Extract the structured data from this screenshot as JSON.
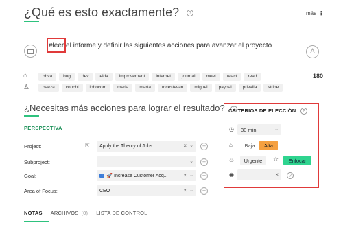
{
  "header": {
    "title": "¿Qué es esto exactamente?",
    "more_label": "más",
    "help_glyph": "?"
  },
  "action": {
    "hashtag": "#leer",
    "text": " el informe y definir las siguientes acciones para avanzar el proyecto"
  },
  "tags": [
    "bbva",
    "bug",
    "dev",
    "elda",
    "improvement",
    "internet",
    "journal",
    "meet",
    "react",
    "read"
  ],
  "tags_count": "180",
  "people": [
    "baeza",
    "conchi",
    "lobocom",
    "maria",
    "marta",
    "mcestevan",
    "miguel",
    "paypal",
    "privalia",
    "stripe"
  ],
  "next_actions": {
    "title": "¿Necesitas más acciones para lograr el resultado?",
    "section": "PERSPECTIVA",
    "fields": {
      "project_label": "Project:",
      "project_value": "Apply the Theory of Jobs",
      "subproject_label": "Subproject:",
      "subproject_value": "",
      "goal_label": "Goal:",
      "goal_badge": "1",
      "goal_value": "🚀 Increase Customer Acq...",
      "area_label": "Area of Focus:",
      "area_value": "CEO"
    }
  },
  "criteria": {
    "title": "CRITERIOS DE ELECCIÓN",
    "time": "30 min",
    "energy_low": "Baja",
    "energy_high": "Alta",
    "urgent": "Urgente",
    "focus": "Enfocar"
  },
  "tabs": [
    {
      "label": "NOTAS",
      "count": ""
    },
    {
      "label": "ARCHIVOS",
      "count": "(0)"
    },
    {
      "label": "LISTA DE CONTROL",
      "count": ""
    }
  ],
  "colors": {
    "accent": "#2ec27e",
    "highlight_border": "#e03a3a",
    "alta": "#f5a040",
    "enfocar": "#2fd48f"
  }
}
